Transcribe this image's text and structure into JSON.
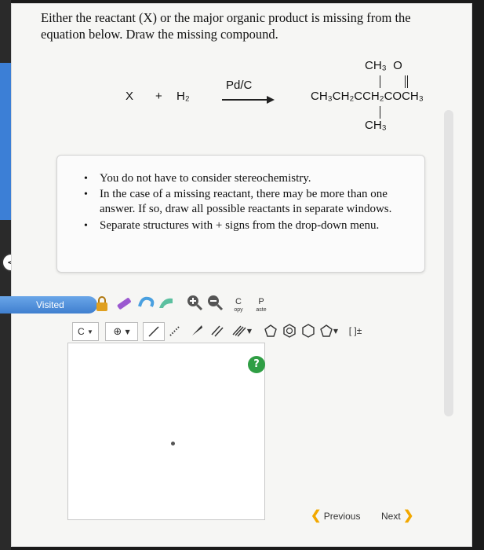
{
  "question": {
    "line1": "Either the reactant (X) or the major organic product is missing from the",
    "line2": "equation below. Draw the missing compound."
  },
  "equation": {
    "reactant": "X",
    "plus": "+",
    "reagent": "H₂",
    "catalyst": "Pd/C",
    "product_top": "CH₃  O",
    "product_main": "CH₃CH₂CCH₂COCH₃",
    "product_bottom": "CH₃"
  },
  "notes": [
    "You do not have to consider stereochemistry.",
    "In the case of a missing reactant, there may be more than one answer. If so, draw all possible reactants in separate windows.",
    "Separate structures with + signs from the drop-down menu."
  ],
  "visited_label": "Visited",
  "toolbar": {
    "copy_top": "C",
    "copy_bottom": "opy",
    "paste_top": "P",
    "paste_bottom": "aste",
    "element_label": "C",
    "charge_label": "[ ]±"
  },
  "help_label": "?",
  "nav": {
    "previous_label": "Previous",
    "next_label": "Next"
  }
}
